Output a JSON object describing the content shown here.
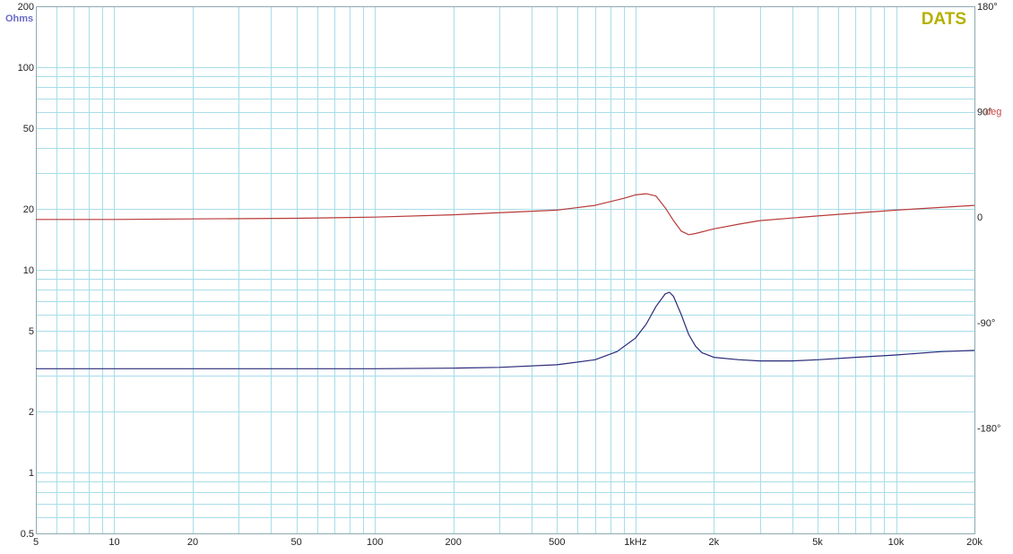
{
  "brand": {
    "label": "DATS",
    "color": "#b5b000"
  },
  "colors": {
    "grid": "#a8dde8",
    "frame": "#8fa9b0",
    "impedance": "#2a2a7a",
    "phase": "#b83a3a",
    "ohms_label": "#6a6ac8",
    "deg_label": "#c84a4a"
  },
  "chart_data": {
    "type": "line",
    "xscale": "log",
    "yscale": "log",
    "xlim": [
      5,
      20000
    ],
    "ylim": [
      0.5,
      200
    ],
    "y2lim": [
      -270,
      180
    ],
    "grid": true,
    "x_ticks": [
      {
        "v": 5,
        "label": "5"
      },
      {
        "v": 10,
        "label": "10"
      },
      {
        "v": 20,
        "label": "20"
      },
      {
        "v": 50,
        "label": "50"
      },
      {
        "v": 100,
        "label": "100"
      },
      {
        "v": 200,
        "label": "200"
      },
      {
        "v": 500,
        "label": "500"
      },
      {
        "v": 1000,
        "label": "1kHz"
      },
      {
        "v": 2000,
        "label": "2k"
      },
      {
        "v": 5000,
        "label": "5k"
      },
      {
        "v": 10000,
        "label": "10k"
      },
      {
        "v": 20000,
        "label": "20k"
      }
    ],
    "y_ticks": [
      {
        "v": 0.5,
        "label": "0.5"
      },
      {
        "v": 1,
        "label": "1"
      },
      {
        "v": 2,
        "label": "2"
      },
      {
        "v": 5,
        "label": "5"
      },
      {
        "v": 10,
        "label": "10"
      },
      {
        "v": 20,
        "label": "20"
      },
      {
        "v": 50,
        "label": "50"
      },
      {
        "v": 100,
        "label": "100"
      },
      {
        "v": 200,
        "label": "200"
      }
    ],
    "y2_ticks": [
      {
        "v": 180,
        "label": "180°"
      },
      {
        "v": 90,
        "label": "90°"
      },
      {
        "v": 0,
        "label": "0"
      },
      {
        "v": -90,
        "label": "-90°"
      },
      {
        "v": -180,
        "label": "-180°"
      }
    ],
    "ylabel": "Ohms",
    "y2label": "deg",
    "series": [
      {
        "key": "impedance",
        "axis": "y",
        "x": [
          5,
          10,
          20,
          50,
          100,
          200,
          300,
          500,
          700,
          850,
          1000,
          1100,
          1200,
          1300,
          1350,
          1400,
          1500,
          1600,
          1700,
          1800,
          2000,
          2500,
          3000,
          4000,
          5000,
          7000,
          10000,
          15000,
          20000
        ],
        "values": [
          3.25,
          3.25,
          3.25,
          3.25,
          3.25,
          3.27,
          3.3,
          3.4,
          3.6,
          3.95,
          4.6,
          5.4,
          6.6,
          7.6,
          7.75,
          7.4,
          6.0,
          4.8,
          4.2,
          3.9,
          3.7,
          3.6,
          3.55,
          3.55,
          3.6,
          3.7,
          3.8,
          3.95,
          4.0
        ]
      },
      {
        "key": "phase",
        "axis": "y2",
        "x": [
          5,
          10,
          20,
          50,
          100,
          200,
          500,
          700,
          900,
          1000,
          1100,
          1200,
          1300,
          1400,
          1500,
          1600,
          1700,
          2000,
          2500,
          3000,
          5000,
          10000,
          20000
        ],
        "values": [
          -2,
          -2,
          -1.5,
          -1,
          0,
          2,
          6,
          10,
          16,
          19,
          20,
          18,
          8,
          -3,
          -12,
          -15,
          -14,
          -10,
          -6,
          -3,
          1,
          6,
          10
        ]
      }
    ]
  }
}
